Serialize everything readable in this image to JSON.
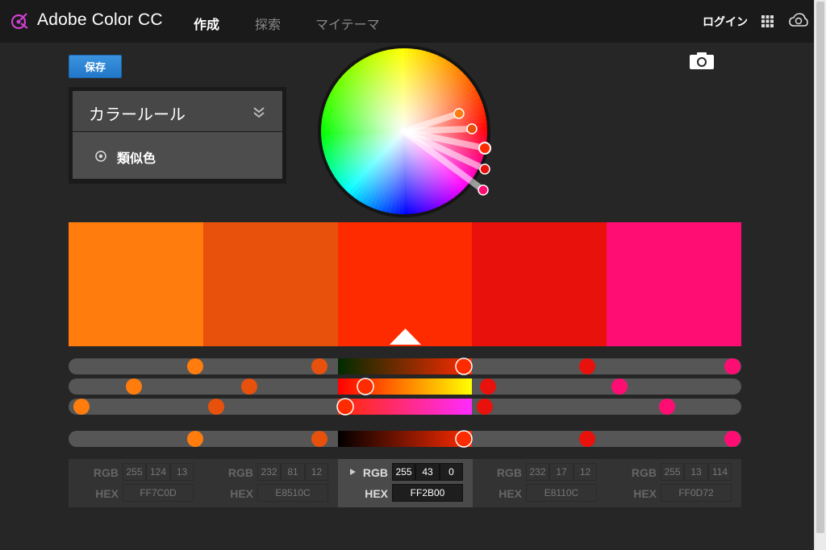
{
  "header": {
    "brand": "Adobe Color CC",
    "nav": [
      {
        "label": "作成",
        "active": true
      },
      {
        "label": "探索",
        "active": false
      },
      {
        "label": "マイテーマ",
        "active": false
      }
    ],
    "login": "ログイン"
  },
  "toolbar": {
    "save_label": "保存"
  },
  "rule": {
    "title": "カラールール",
    "selected": "類似色"
  },
  "colors": [
    {
      "hex": "FF7C0D",
      "rgb": [
        "255",
        "124",
        "13"
      ],
      "swatch": "#FF7C0D"
    },
    {
      "hex": "E8510C",
      "rgb": [
        "232",
        "81",
        "12"
      ],
      "swatch": "#E8510C"
    },
    {
      "hex": "FF2B00",
      "rgb": [
        "255",
        "43",
        "0"
      ],
      "swatch": "#FF2B00"
    },
    {
      "hex": "E8110C",
      "rgb": [
        "232",
        "17",
        "12"
      ],
      "swatch": "#E8110C"
    },
    {
      "hex": "FF0D72",
      "rgb": [
        "255",
        "13",
        "114"
      ],
      "swatch": "#FF0D72"
    }
  ],
  "selected_index": 2,
  "value_labels": {
    "rgb": "RGB",
    "hex": "HEX"
  },
  "icons": {
    "logo": "adobe-color-logo-icon",
    "apps": "app-grid-icon",
    "cloud": "creative-cloud-icon",
    "camera": "camera-icon",
    "chevron": "double-chevron-down-icon",
    "radio": "radio-icon"
  }
}
